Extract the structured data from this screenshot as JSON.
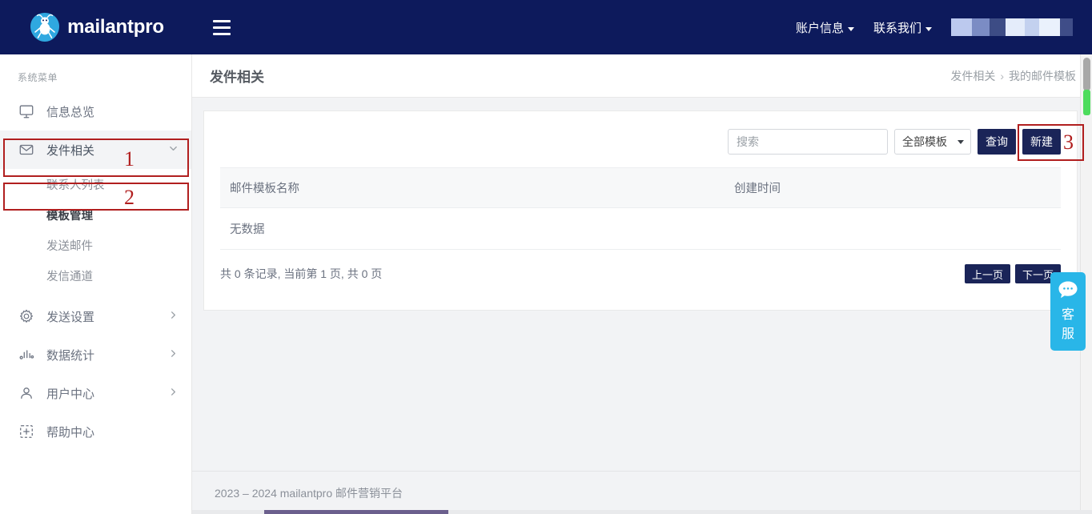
{
  "brand": {
    "name": "mailantpro",
    "logo_icon": "ant-mascot-logo"
  },
  "topbar": {
    "menu_toggle_icon": "hamburger-icon",
    "nav": [
      {
        "label": "账户信息",
        "icon": "chevron-down-icon"
      },
      {
        "label": "联系我们",
        "icon": "chevron-down-icon"
      }
    ],
    "account_name_redacted": "",
    "redacted_swatches": [
      "#bcc9ee",
      "#7b8cc4",
      "#3d4c85",
      "#e4ecfa",
      "#c3d1ef",
      "#eaf1fc",
      "#3f4d88"
    ]
  },
  "sidebar": {
    "title": "系统菜单",
    "items": [
      {
        "label": "信息总览",
        "icon": "monitor-icon",
        "arrow": ""
      },
      {
        "label": "发件相关",
        "icon": "envelope-icon",
        "arrow": "chevron-down-icon",
        "active": true
      },
      {
        "label": "发送设置",
        "icon": "gear-icon",
        "arrow": "chevron-right-icon"
      },
      {
        "label": "数据统计",
        "icon": "bar-chart-icon",
        "arrow": "chevron-right-icon"
      },
      {
        "label": "用户中心",
        "icon": "user-icon",
        "arrow": "chevron-right-icon"
      },
      {
        "label": "帮助中心",
        "icon": "dashed-plus-icon",
        "arrow": ""
      }
    ],
    "submenu": [
      {
        "label": "联系人列表",
        "current": false
      },
      {
        "label": "模板管理",
        "current": true
      },
      {
        "label": "发送邮件",
        "current": false
      },
      {
        "label": "发信通道",
        "current": false
      }
    ]
  },
  "page": {
    "title": "发件相关",
    "breadcrumb": {
      "parent": "发件相关",
      "separator": "›",
      "current": "我的邮件模板"
    }
  },
  "toolbar": {
    "search_placeholder": "搜索",
    "search_value": "",
    "search_icon": "search-icon",
    "filter_selected": "全部模板",
    "filter_options": [
      "全部模板"
    ],
    "query_label": "查询",
    "create_label": "新建"
  },
  "table": {
    "columns": [
      "邮件模板名称",
      "创建时间"
    ],
    "rows": [],
    "empty_text": "无数据"
  },
  "pagination": {
    "info_prefix": "共",
    "total_records": "0",
    "info_mid1": "条记录, 当前第",
    "current_page": "1",
    "info_mid2": "页, 共",
    "total_pages": "0",
    "info_suffix": "页",
    "info_full": "共 0 条记录, 当前第  1  页, 共   0   页",
    "prev_label": "上一页",
    "next_label": "下一页"
  },
  "footer": {
    "text": "2023 – 2024 mailantpro 邮件营销平台"
  },
  "support_widget": {
    "icon": "chat-bubble-icon",
    "line1": "客",
    "line2": "服",
    "color": "#29b6e8"
  },
  "annotations": [
    {
      "number": "1",
      "target": "sidebar-item-发件相关"
    },
    {
      "number": "2",
      "target": "submenu-item-联系人列表"
    },
    {
      "number": "3",
      "target": "create-button"
    }
  ],
  "colors": {
    "topbar_bg": "#0d1a5c",
    "button_primary": "#1a2458",
    "annotation_red": "#b11f1f",
    "support_cyan": "#29b6e8",
    "scrollbar_green": "#4ddc5c"
  }
}
